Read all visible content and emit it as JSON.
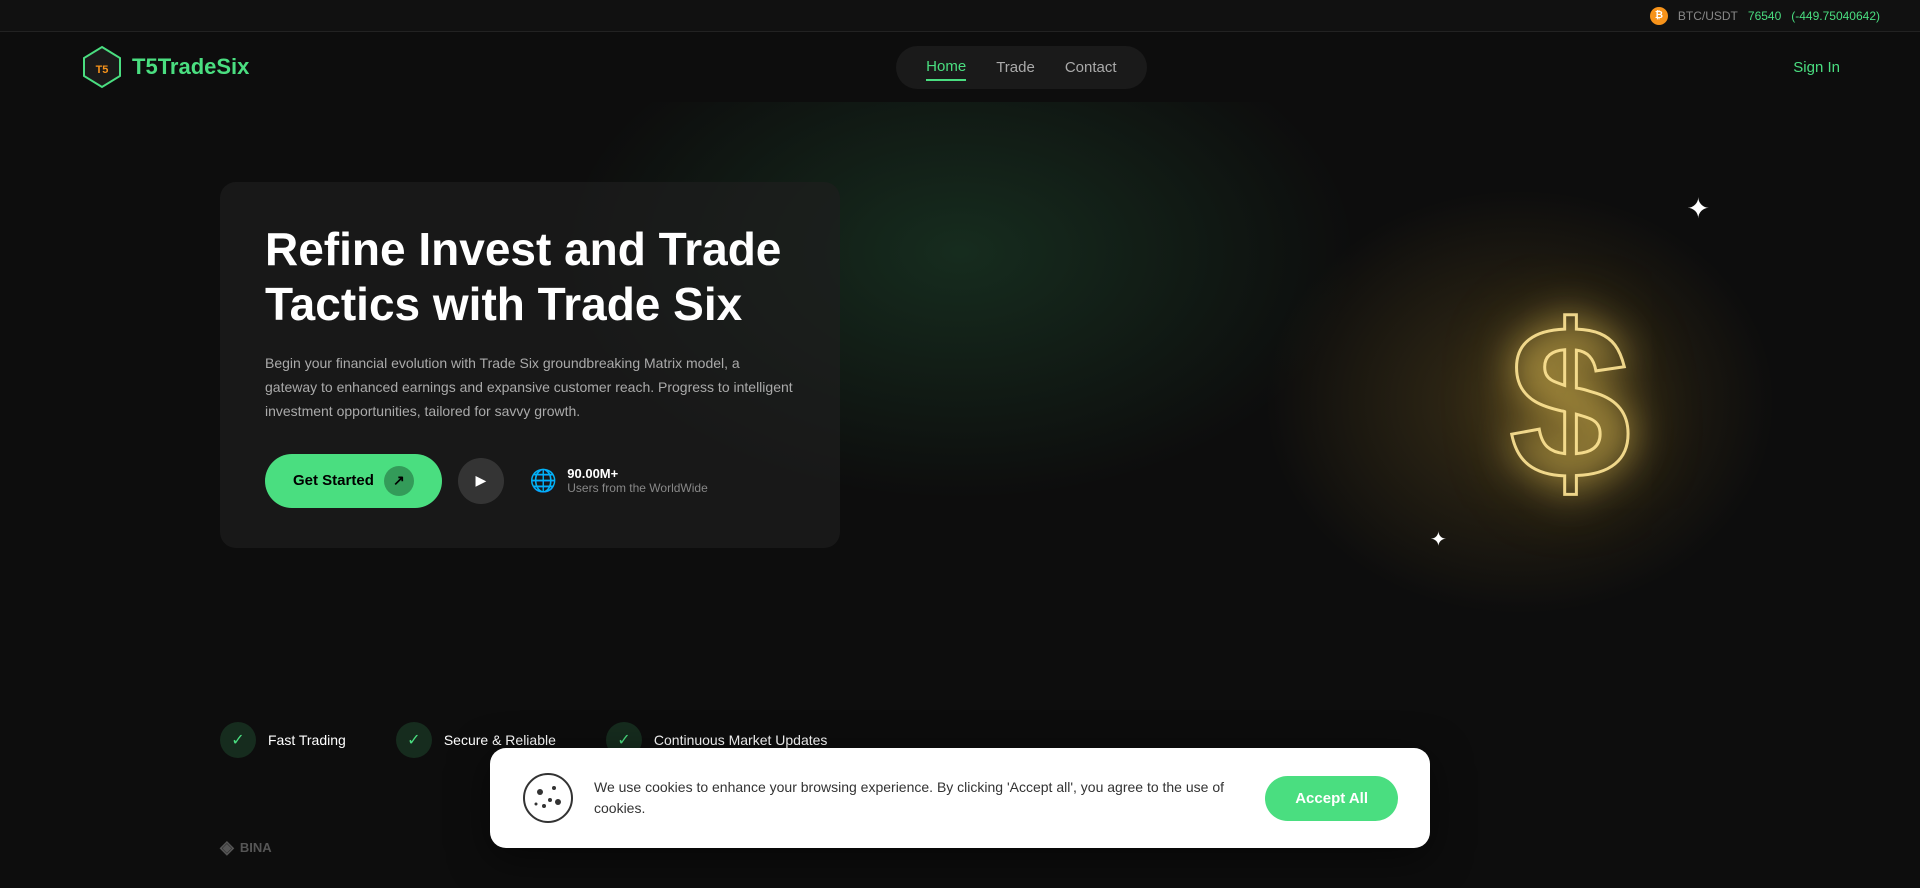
{
  "ticker": {
    "pair": "BTC/USDT",
    "price": "76540",
    "change": "(-449.75040642)"
  },
  "header": {
    "logo_text_t5": "T5",
    "logo_text_name": "TradeSix",
    "nav_items": [
      {
        "label": "Home",
        "active": true
      },
      {
        "label": "Trade",
        "active": false
      },
      {
        "label": "Contact",
        "active": false
      }
    ],
    "sign_in_label": "Sign In"
  },
  "hero": {
    "title": "Refine Invest and Trade Tactics with Trade Six",
    "description": "Begin your financial evolution with Trade Six groundbreaking Matrix model, a gateway to enhanced earnings and expansive customer reach. Progress to intelligent investment opportunities, tailored for savvy growth.",
    "get_started_label": "Get Started",
    "stats_number": "90.00M+",
    "stats_label": "Users from the WorldWide"
  },
  "features": [
    {
      "icon": "✓",
      "label": "Fast Trading"
    },
    {
      "icon": "✓",
      "label": "Secure & Reliable"
    },
    {
      "icon": "✓",
      "label": "Continuous Market Updates"
    }
  ],
  "partners": [
    {
      "symbol": "◇",
      "name": "BINA"
    },
    {
      "symbol": "◇",
      "name": ""
    },
    {
      "symbol": "◇",
      "name": ""
    }
  ],
  "cookie": {
    "message": "We use cookies to enhance your browsing experience. By clicking 'Accept all', you agree to the use of cookies.",
    "accept_label": "Accept All"
  }
}
